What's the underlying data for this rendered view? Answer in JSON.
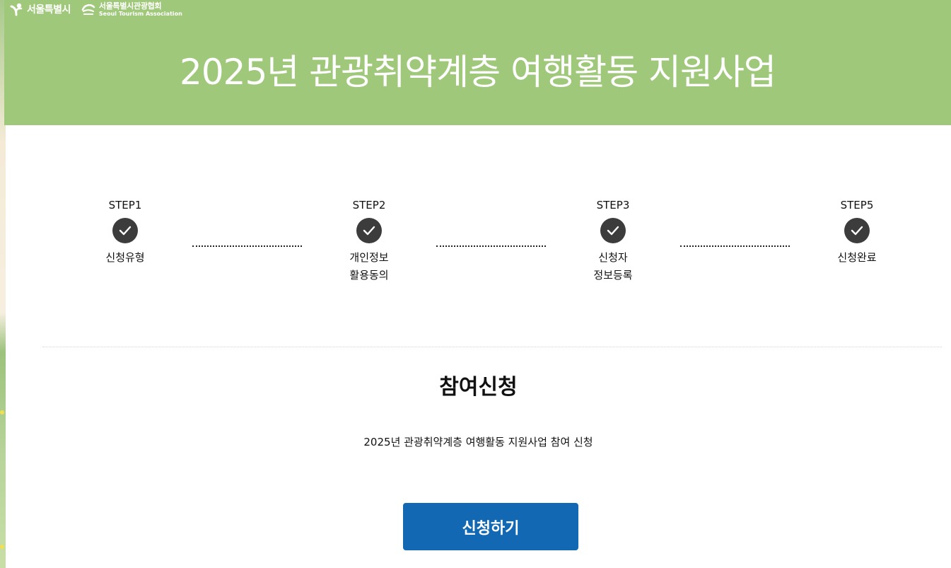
{
  "header": {
    "logo_seoul": "서울특별시",
    "logo_sta_ko": "서울특별시관광협회",
    "logo_sta_en": "Seoul Tourism Association",
    "title": "2025년 관광취약계층 여행활동 지원사업",
    "background_color": "#a0c87b"
  },
  "stepper": {
    "steps": [
      {
        "label": "STEP1",
        "name": "신청유형",
        "completed": true
      },
      {
        "label": "STEP2",
        "name": "개인정보\n활용동의",
        "completed": true
      },
      {
        "label": "STEP3",
        "name": "신청자\n정보등록",
        "completed": true
      },
      {
        "label": "STEP5",
        "name": "신청완료",
        "completed": true
      }
    ],
    "check_color": "#3c3c3c"
  },
  "main": {
    "section_title": "참여신청",
    "description": "2025년 관광취약계층 여행활동 지원사업 참여 신청",
    "apply_button_label": "신청하기",
    "apply_button_color": "#1268b3"
  }
}
